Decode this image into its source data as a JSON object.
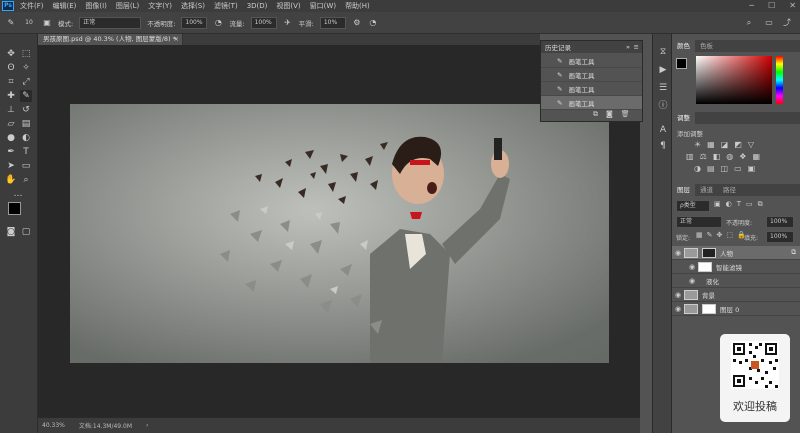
{
  "menu": {
    "app_badge": "Ps",
    "items": [
      "文件(F)",
      "编辑(E)",
      "图像(I)",
      "图层(L)",
      "文字(Y)",
      "选择(S)",
      "滤镜(T)",
      "3D(D)",
      "视图(V)",
      "窗口(W)",
      "帮助(H)"
    ],
    "window_controls": [
      "─",
      "☐",
      "✕"
    ]
  },
  "options": {
    "brush_size": "10",
    "mode_label": "模式:",
    "mode_value": "正常",
    "opacity_label": "不透明度:",
    "opacity_value": "100%",
    "flow_label": "流量:",
    "flow_value": "100%",
    "smooth_label": "平滑:",
    "smooth_value": "10%"
  },
  "document": {
    "tab_title": "男孩原图.psd @ 40.3% (人物, 图层蒙版/8) *",
    "close": "×"
  },
  "status": {
    "zoom": "40.33%",
    "doc_size": "文档:14.3M/49.0M",
    "arrow": "›"
  },
  "history": {
    "title": "历史记录",
    "collapse": "»",
    "menu": "≡",
    "items": [
      "画笔工具",
      "画笔工具",
      "画笔工具",
      "画笔工具"
    ],
    "selected_index": 3
  },
  "panels": {
    "color_tabs": [
      "颜色",
      "色板"
    ],
    "adjust_tab": "调整",
    "adjust_subtitle": "添加调整",
    "layer_tabs": [
      "图层",
      "通道",
      "路径"
    ],
    "kind_label": "ρ类型",
    "blend_mode": "正常",
    "opacity_label": "不透明度:",
    "opacity_value": "100%",
    "lock_label": "锁定:",
    "fill_label": "填充:",
    "fill_value": "100%",
    "layers": [
      {
        "name": "人物",
        "indent": 0
      },
      {
        "name": "智能滤镜",
        "indent": 1
      },
      {
        "name": "液化",
        "indent": 2
      },
      {
        "name": "背景",
        "indent": 0
      },
      {
        "name": "图层 0",
        "indent": 0
      }
    ]
  },
  "colors": {
    "picker_hue": "#d00000",
    "foreground": "#000000",
    "background": "#ffffff"
  },
  "watermark": {
    "label": "欢迎投稿"
  }
}
